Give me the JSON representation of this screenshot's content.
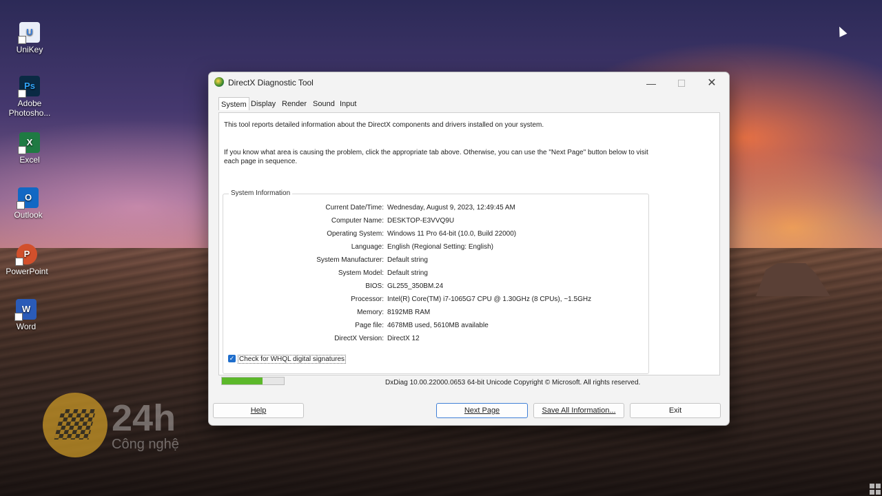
{
  "desktop": {
    "icons": [
      {
        "label": "UniKey",
        "icon": "unikey-icon",
        "color": "#3b7fd9"
      },
      {
        "label": "Adobe Photosho...",
        "icon": "photoshop-icon",
        "color": "#0a2a44"
      },
      {
        "label": "Excel",
        "icon": "excel-icon",
        "color": "#1f7a43"
      },
      {
        "label": "Outlook",
        "icon": "outlook-icon",
        "color": "#1268c4"
      },
      {
        "label": "PowerPoint",
        "icon": "powerpoint-icon",
        "color": "#d2502c"
      },
      {
        "label": "Word",
        "icon": "word-icon",
        "color": "#2a5bb8"
      }
    ],
    "icon_glyphs": {
      "unikey": "U",
      "photoshop": "Ps",
      "excel": "X",
      "outlook": "O",
      "powerpoint": "P",
      "word": "W"
    }
  },
  "window": {
    "title": "DirectX Diagnostic Tool",
    "controls": {
      "minimize": "—",
      "maximize": "☐",
      "close": "✕"
    },
    "tabs": [
      "System",
      "Display",
      "Render",
      "Sound",
      "Input"
    ],
    "active_tab": "System",
    "intro_line1": "This tool reports detailed information about the DirectX components and drivers installed on your system.",
    "intro_line2": "If you know what area is causing the problem, click the appropriate tab above.  Otherwise, you can use the \"Next Page\" button below to visit each page in sequence.",
    "group_title": "System Information",
    "system_info": [
      {
        "key": "Current Date/Time:",
        "value": "Wednesday, August 9, 2023, 12:49:45 AM"
      },
      {
        "key": "Computer Name:",
        "value": "DESKTOP-E3VVQ9U"
      },
      {
        "key": "Operating System:",
        "value": "Windows 11 Pro 64-bit (10.0, Build 22000)"
      },
      {
        "key": "Language:",
        "value": "English (Regional Setting: English)"
      },
      {
        "key": "System Manufacturer:",
        "value": "Default string"
      },
      {
        "key": "System Model:",
        "value": "Default string"
      },
      {
        "key": "BIOS:",
        "value": "GL255_350BM.24"
      },
      {
        "key": "Processor:",
        "value": "Intel(R) Core(TM) i7-1065G7 CPU @ 1.30GHz (8 CPUs), ~1.5GHz"
      },
      {
        "key": "Memory:",
        "value": "8192MB RAM"
      },
      {
        "key": "Page file:",
        "value": "4678MB used, 5610MB available"
      },
      {
        "key": "DirectX Version:",
        "value": "DirectX 12"
      }
    ],
    "whql_checkbox": {
      "label": "Check for WHQL digital signatures",
      "checked": true,
      "glyph": "✓"
    },
    "progress": 0.65,
    "progress_color": "#5cb82a",
    "footer_info": "DxDiag 10.00.22000.0653 64-bit Unicode  Copyright © Microsoft. All rights reserved.",
    "buttons": {
      "help": "Help",
      "next_page": "Next Page",
      "save_all": "Save All Information...",
      "exit": "Exit"
    }
  },
  "watermark": {
    "big": "24h",
    "small": "Công nghệ"
  }
}
